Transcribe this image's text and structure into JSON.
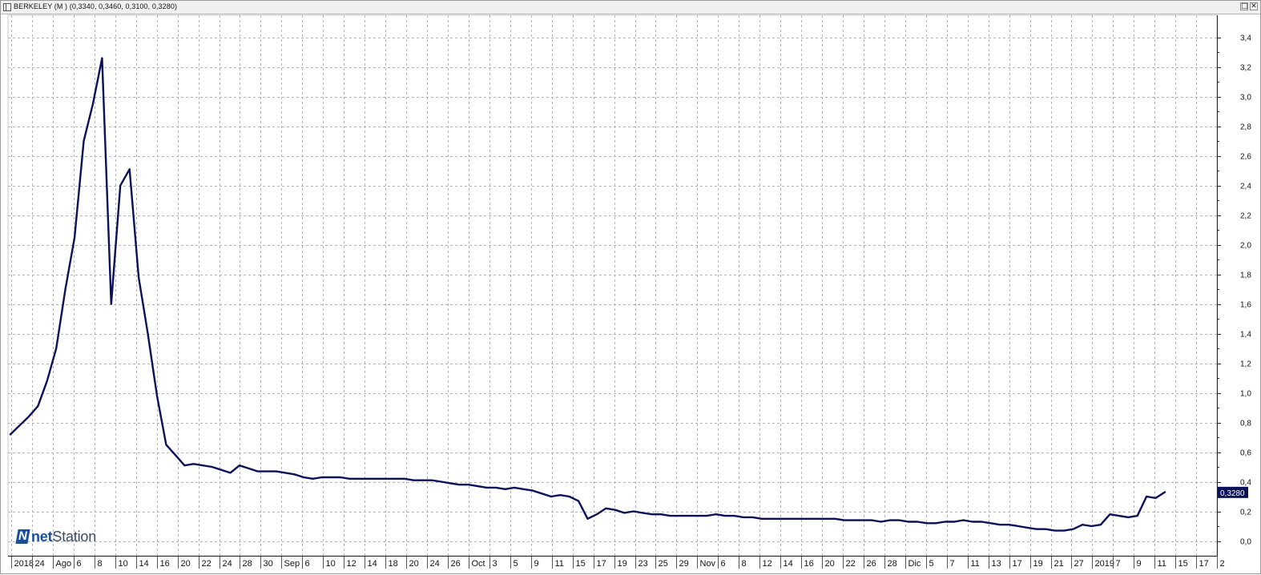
{
  "window": {
    "title": "BERKELEY (M ) (0,3340, 0,3460, 0,3100, 0,3280)",
    "buttons": [
      "□",
      "✕"
    ]
  },
  "logo": {
    "brand_bold": "net",
    "brand_rest": "Station"
  },
  "colors": {
    "series": "#0b1158",
    "grid": "#b4b4b4",
    "axis": "#222222",
    "last_value_bg": "#0b1158",
    "last_value_text": "#ffffff"
  },
  "chart_data": {
    "type": "line",
    "title": "",
    "xlabel": "",
    "ylabel": "",
    "ylim": [
      -0.1,
      3.55
    ],
    "grid": true,
    "y_axis_position": "right",
    "y_ticks": [
      "0,0",
      "0,2",
      "0,4",
      "0,6",
      "0,8",
      "1,0",
      "1,2",
      "1,4",
      "1,6",
      "1,8",
      "2,0",
      "2,2",
      "2,4",
      "2,6",
      "2,8",
      "3,0",
      "3,2",
      "3,4"
    ],
    "x_ticks": [
      "2018",
      "24",
      "Ago",
      "6",
      "8",
      "10",
      "14",
      "16",
      "20",
      "22",
      "24",
      "28",
      "30",
      "Sep",
      "6",
      "10",
      "12",
      "14",
      "18",
      "20",
      "24",
      "26",
      "Oct",
      "3",
      "5",
      "9",
      "11",
      "15",
      "17",
      "19",
      "23",
      "25",
      "29",
      "Nov",
      "6",
      "8",
      "12",
      "14",
      "16",
      "20",
      "22",
      "26",
      "28",
      "Dic",
      "5",
      "7",
      "11",
      "13",
      "17",
      "19",
      "21",
      "27",
      "2019",
      "7",
      "9",
      "11",
      "15",
      "17",
      "2"
    ],
    "last_value_label": "0,3280",
    "series": [
      {
        "values": [
          0.72,
          0.78,
          0.84,
          0.91,
          1.08,
          1.3,
          1.7,
          2.05,
          2.7,
          2.95,
          3.26,
          1.6,
          2.4,
          2.51,
          1.78,
          1.4,
          0.98,
          0.65,
          0.58,
          0.51,
          0.52,
          0.51,
          0.5,
          0.48,
          0.46,
          0.51,
          0.49,
          0.47,
          0.47,
          0.47,
          0.46,
          0.45,
          0.43,
          0.42,
          0.43,
          0.43,
          0.43,
          0.42,
          0.42,
          0.42,
          0.42,
          0.42,
          0.42,
          0.42,
          0.41,
          0.41,
          0.41,
          0.4,
          0.39,
          0.38,
          0.38,
          0.37,
          0.36,
          0.36,
          0.35,
          0.36,
          0.35,
          0.34,
          0.32,
          0.3,
          0.31,
          0.3,
          0.27,
          0.15,
          0.18,
          0.22,
          0.21,
          0.19,
          0.2,
          0.19,
          0.18,
          0.18,
          0.17,
          0.17,
          0.17,
          0.17,
          0.17,
          0.18,
          0.17,
          0.17,
          0.16,
          0.16,
          0.15,
          0.15,
          0.15,
          0.15,
          0.15,
          0.15,
          0.15,
          0.15,
          0.15,
          0.14,
          0.14,
          0.14,
          0.14,
          0.13,
          0.14,
          0.14,
          0.13,
          0.13,
          0.12,
          0.12,
          0.13,
          0.13,
          0.14,
          0.13,
          0.13,
          0.12,
          0.11,
          0.11,
          0.1,
          0.09,
          0.08,
          0.08,
          0.07,
          0.07,
          0.08,
          0.11,
          0.1,
          0.11,
          0.18,
          0.17,
          0.16,
          0.17,
          0.3,
          0.29,
          0.33
        ]
      }
    ]
  }
}
